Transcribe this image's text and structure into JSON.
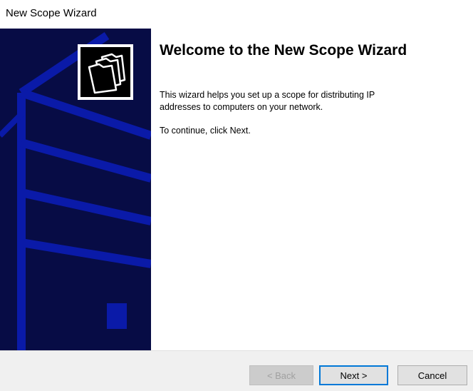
{
  "window": {
    "title": "New Scope Wizard"
  },
  "banner": {
    "icon": "folders-icon",
    "background_color": "#070c45",
    "accent_color": "#0a1aa8"
  },
  "content": {
    "heading": "Welcome to the New Scope Wizard",
    "description": "This wizard helps you set up a scope for distributing IP addresses to computers on your network.",
    "instruction": "To continue, click Next."
  },
  "footer": {
    "back_label": "< Back",
    "back_enabled": false,
    "next_label": "Next >",
    "next_default": true,
    "cancel_label": "Cancel"
  }
}
